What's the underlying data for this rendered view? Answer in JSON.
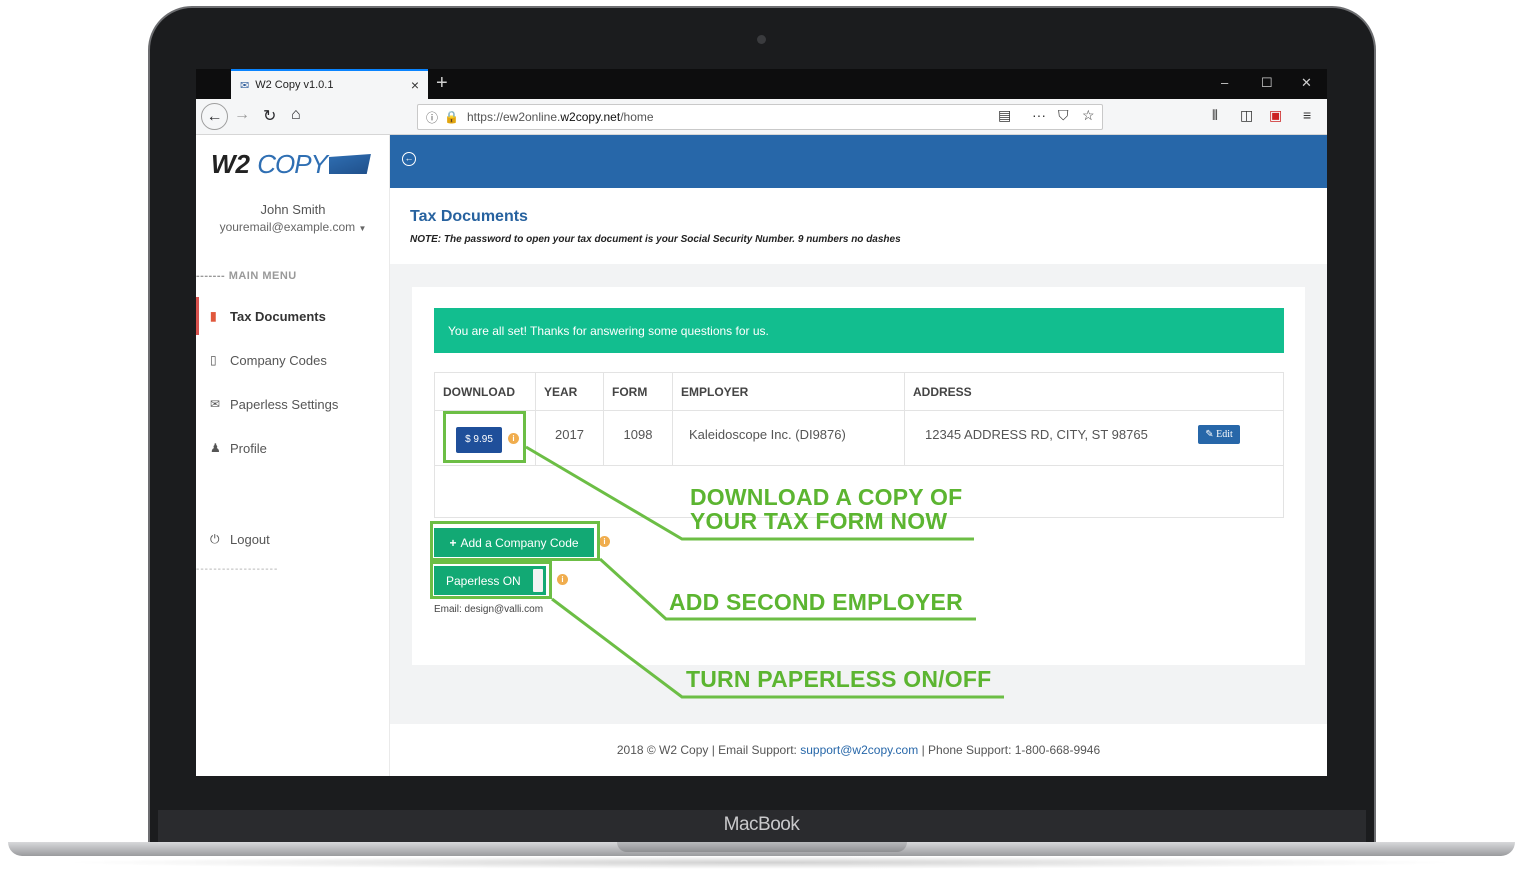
{
  "device": {
    "label": "MacBook"
  },
  "browser": {
    "tab_title": "W2 Copy v1.0.1",
    "url_prefix": "https://ew2online.",
    "url_host": "w2copy.net",
    "url_path": "/home"
  },
  "app": {
    "logo_w2": "W2",
    "logo_copy": "COPY",
    "user_name": "John Smith",
    "user_email": "youremail@example.com",
    "menu_heading": "------- MAIN MENU",
    "menu": [
      {
        "label": "Tax Documents",
        "icon": "file-icon"
      },
      {
        "label": "Company Codes",
        "icon": "building-icon"
      },
      {
        "label": "Paperless Settings",
        "icon": "envelope-icon"
      },
      {
        "label": "Profile",
        "icon": "user-icon"
      }
    ],
    "menu_separator": "-------------------",
    "logout_label": "Logout"
  },
  "page": {
    "title": "Tax Documents",
    "note": "NOTE: The password to open your tax document is your Social Security Number. 9 numbers no dashes",
    "alert": "You are all set! Thanks for answering some questions for us.",
    "table": {
      "headers": [
        "DOWNLOAD",
        "YEAR",
        "FORM",
        "EMPLOYER",
        "ADDRESS"
      ],
      "row": {
        "price": "$ 9.95",
        "year": "2017",
        "form": "1098",
        "employer": "Kaleidoscope Inc. (DI9876)",
        "address": "12345 ADDRESS RD, CITY, ST 98765",
        "edit": "Edit"
      }
    },
    "add_company_label": "Add a Company Code",
    "paperless_label": "Paperless ON",
    "paperless_email": "Email: design@valli.com"
  },
  "footer": {
    "prefix": "2018 © W2 Copy | Email Support: ",
    "email": "support@w2copy.com",
    "suffix": " | Phone Support: 1-800-668-9946"
  },
  "annotations": {
    "download_line1": "DOWNLOAD A COPY OF",
    "download_line2": "YOUR TAX FORM NOW",
    "add_employer": "ADD SECOND EMPLOYER",
    "paperless": "TURN PAPERLESS ON/OFF",
    "color": "#5cb531"
  },
  "colors": {
    "brand_blue": "#2767a9",
    "success_green": "#12be8f",
    "button_green": "#12a974",
    "active_red": "#d9534f"
  }
}
